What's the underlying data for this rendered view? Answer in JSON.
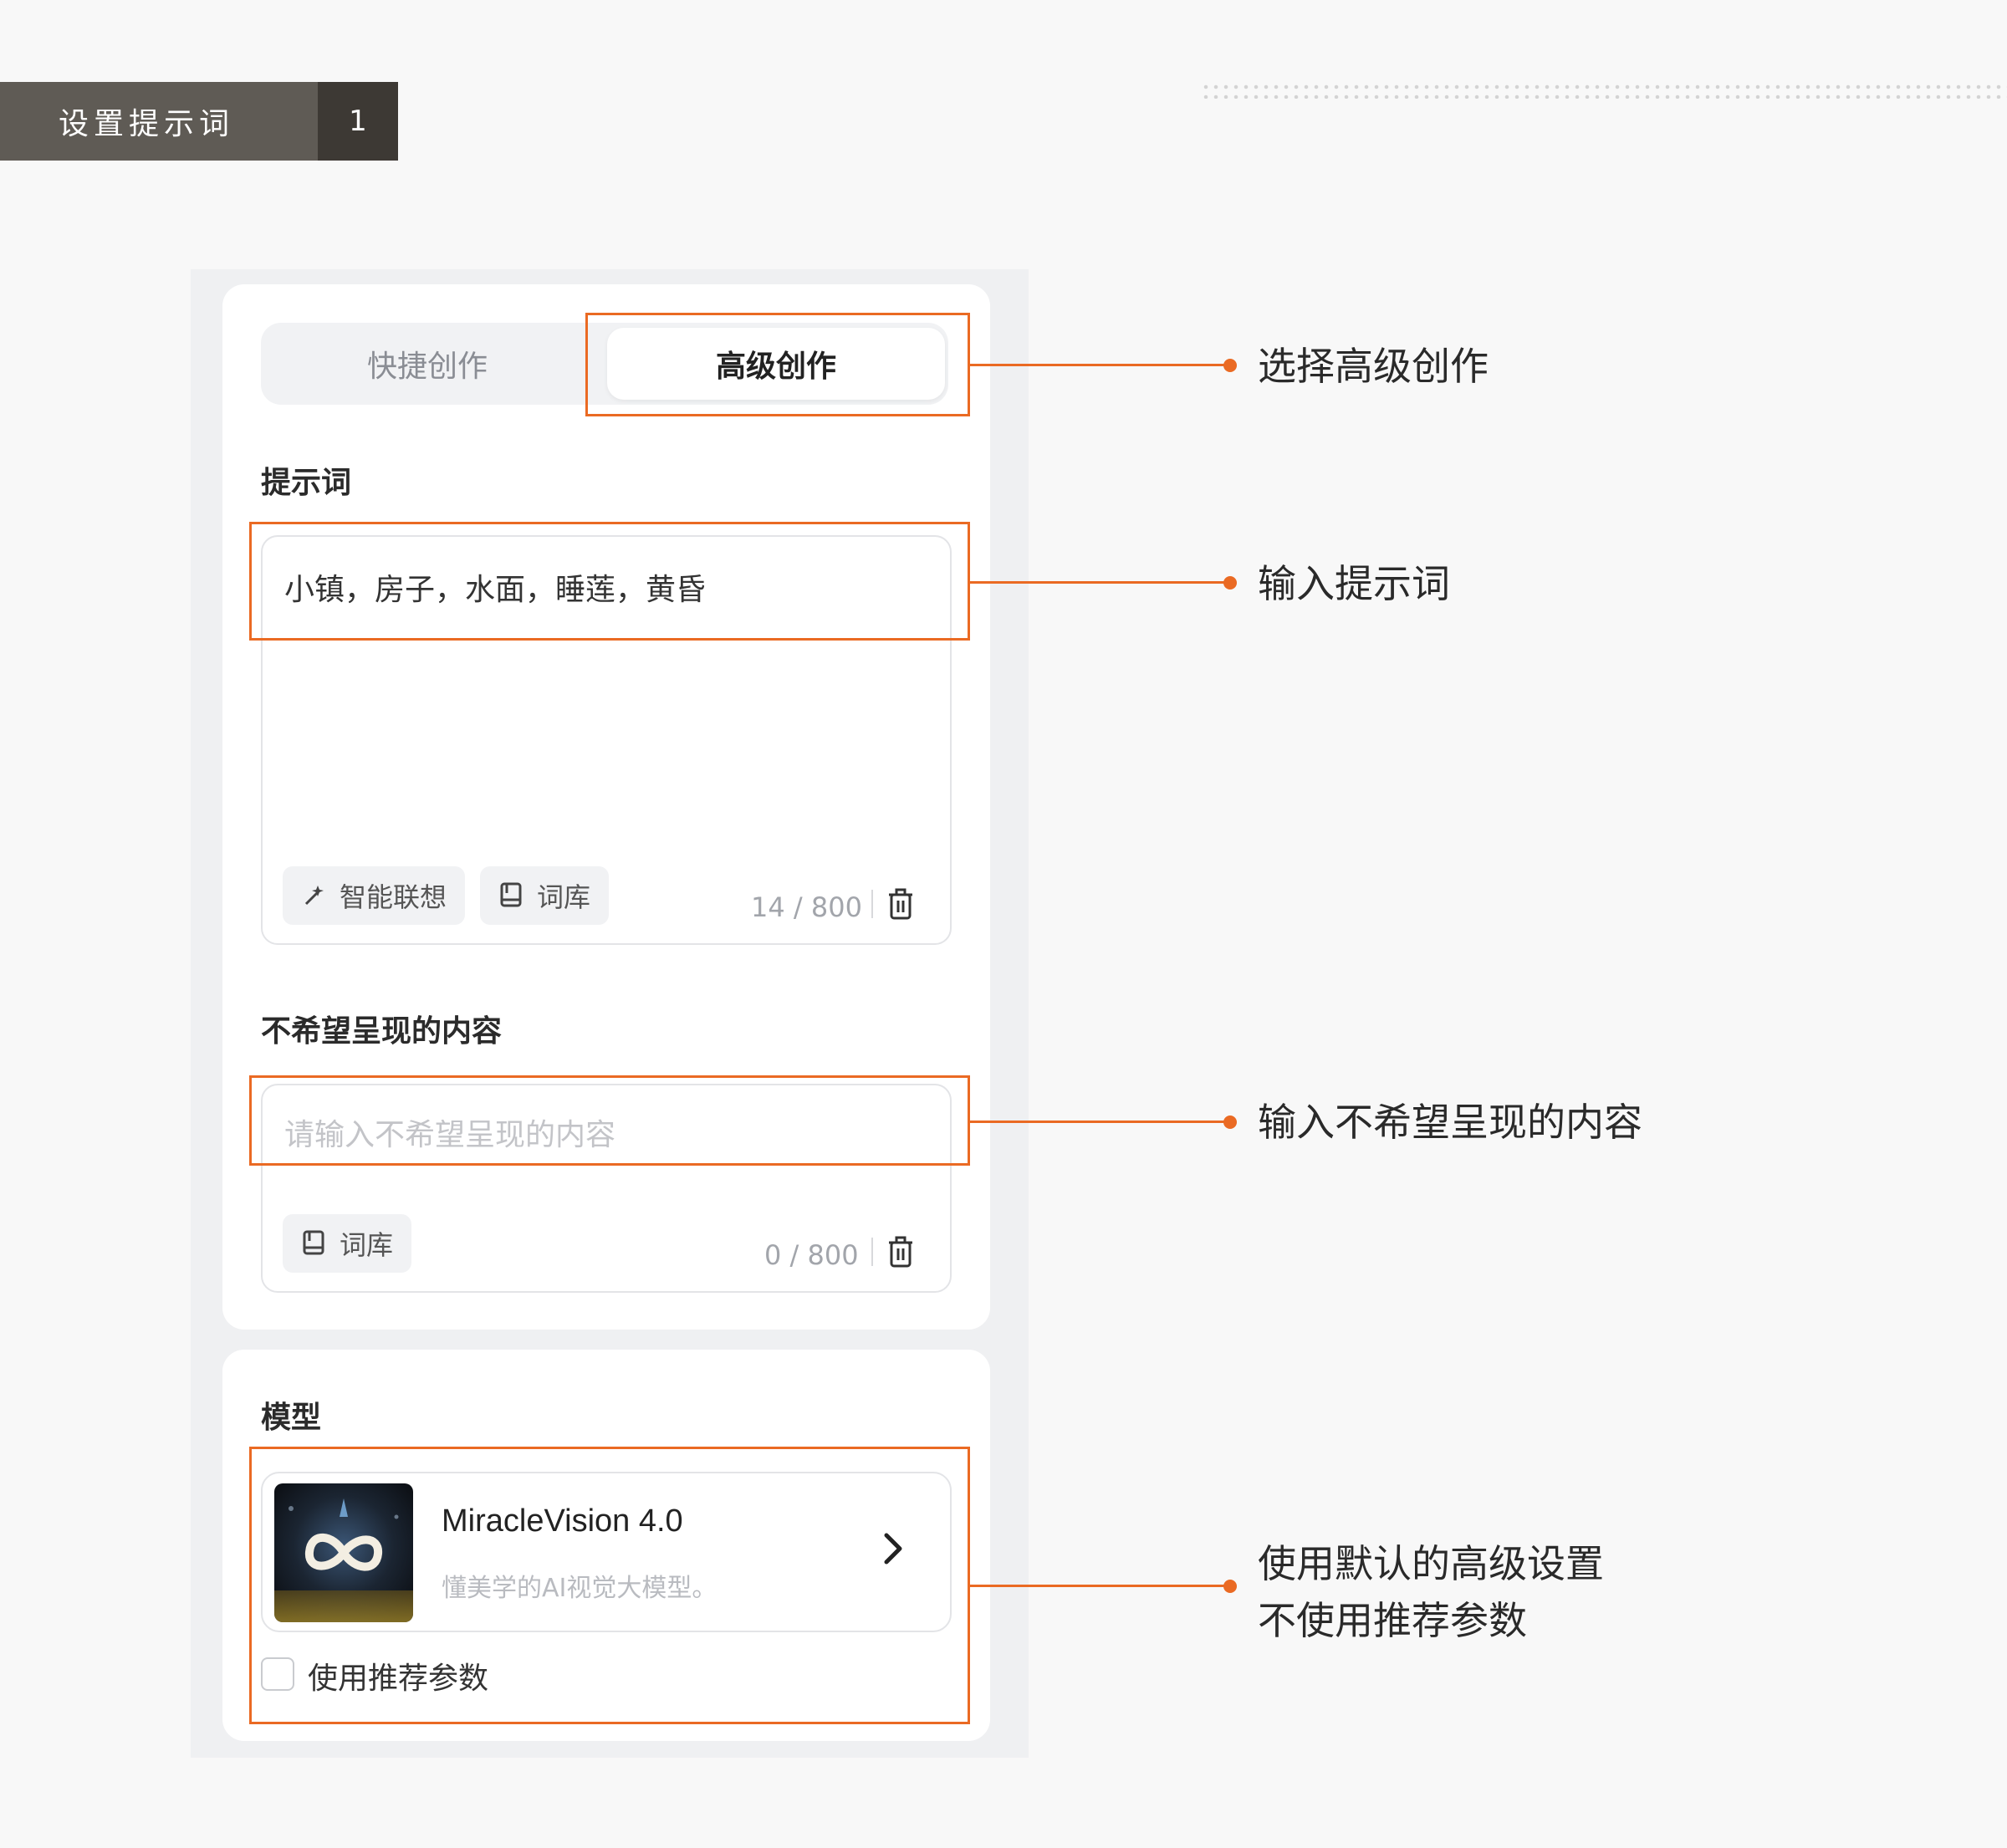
{
  "header": {
    "step_title": "设置提示词",
    "step_number": "1"
  },
  "mode_tabs": {
    "quick": "快捷创作",
    "advanced": "高级创作",
    "selected": "advanced"
  },
  "prompt": {
    "label": "提示词",
    "value": "小镇，房子，水面，睡莲，黄昏",
    "chip_suggest": "智能联想",
    "chip_library": "词库",
    "counter": "14 / 800"
  },
  "negative": {
    "label": "不希望呈现的内容",
    "placeholder": "请输入不希望呈现的内容",
    "chip_library": "词库",
    "counter": "0 / 800"
  },
  "model": {
    "label": "模型",
    "name": "MiracleVision 4.0",
    "description": "懂美学的AI视觉大模型。",
    "use_recommended_label": "使用推荐参数",
    "use_recommended_checked": false
  },
  "annotations": {
    "select_advanced": "选择高级创作",
    "input_prompt": "输入提示词",
    "input_negative": "输入不希望呈现的内容",
    "default_settings_line1": "使用默认的高级设置",
    "default_settings_line2": "不使用推荐参数"
  },
  "colors": {
    "accent": "#ea6a23",
    "tag_bg": "#5f5b55",
    "tag_num_bg": "#3d3934"
  },
  "icons": [
    "wand-icon",
    "book-icon",
    "trash-icon",
    "chevron-right-icon",
    "miraclevision-logo-icon"
  ]
}
